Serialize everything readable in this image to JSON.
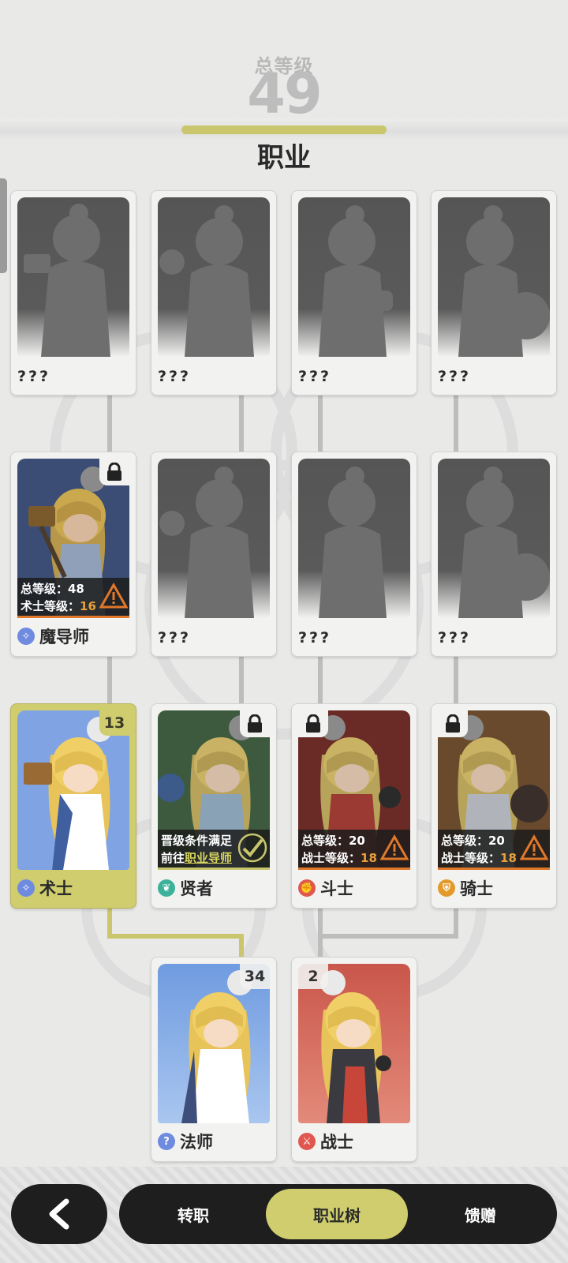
{
  "header": {
    "total_level_label": "总等级",
    "total_level_value": "49",
    "title": "职业"
  },
  "unknown_label": "???",
  "cards": {
    "r1c1": {
      "name": "???"
    },
    "r1c2": {
      "name": "???"
    },
    "r1c3": {
      "name": "???"
    },
    "r1c4": {
      "name": "???"
    },
    "mage_master": {
      "name": "魔导师",
      "req_line1": "总等级：48",
      "req_line2_label": "术士等级：",
      "req_line2_value": "16",
      "locked": true,
      "icon_color": "#6f8be0"
    },
    "r2c2": {
      "name": "???"
    },
    "r2c3": {
      "name": "???"
    },
    "r2c4": {
      "name": "???"
    },
    "warlock": {
      "name": "术士",
      "level": "13",
      "selected": true,
      "icon_color": "#6f8be0",
      "bg": "#7fa3e3"
    },
    "sage": {
      "name": "贤者",
      "req_line1": "晋级条件满足",
      "req_line2_label": "前往",
      "req_line2_link": "职业导师",
      "locked": true,
      "icon_color": "#3db29a",
      "bg": "#3e5a3e"
    },
    "fighter": {
      "name": "斗士",
      "req_line1": "总等级：20",
      "req_line2_label": "战士等级：",
      "req_line2_value": "18",
      "locked": true,
      "icon_color": "#e0574f",
      "bg": "#6a2a26"
    },
    "knight": {
      "name": "骑士",
      "req_line1": "总等级：20",
      "req_line2_label": "战士等级：",
      "req_line2_value": "18",
      "locked": true,
      "icon_color": "#e39a2a",
      "bg": "#6a4a2c"
    },
    "mage": {
      "name": "法师",
      "level": "34",
      "icon_color": "#6f8be0",
      "bg": "#6f9be0"
    },
    "warrior": {
      "name": "战士",
      "level": "2",
      "icon_color": "#e0574f",
      "bg": "#c9564a"
    }
  },
  "tabs": [
    {
      "label": "转职",
      "active": false
    },
    {
      "label": "职业树",
      "active": true
    },
    {
      "label": "馈赠",
      "active": false
    }
  ],
  "colors": {
    "accent": "#cfcd6e",
    "warning": "#e0782a",
    "dock": "#1e1e1e"
  },
  "icons": {
    "back": "chevron-left-icon",
    "lock": "lock-icon",
    "warning": "warning-triangle-icon",
    "check": "check-icon"
  }
}
